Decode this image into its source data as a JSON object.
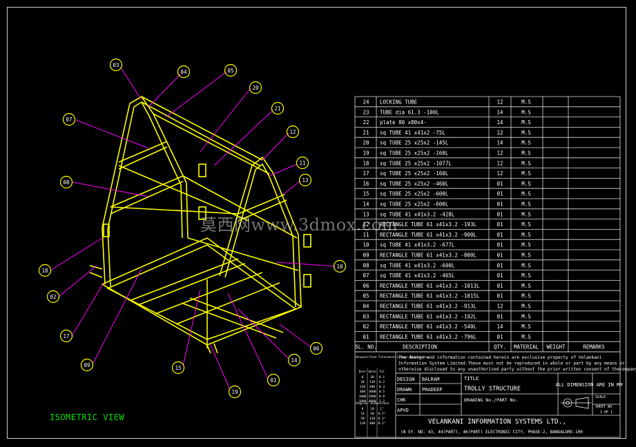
{
  "drawing": {
    "view_label": "ISOMETRIC VIEW",
    "watermark": "莫西网www.3dmox.com",
    "balloons": [
      "03",
      "04",
      "05",
      "20",
      "21",
      "12",
      "11",
      "13",
      "07",
      "08",
      "18",
      "10",
      "02",
      "17",
      "09",
      "15",
      "19",
      "01",
      "14",
      "06"
    ]
  },
  "bom": {
    "rows": [
      {
        "sl": "24",
        "desc": "LOCKING TUBE",
        "qty": "12",
        "mat": "M.S"
      },
      {
        "sl": "23",
        "desc": "TUBE dia 61.3 -100L",
        "qty": "14",
        "mat": "M.S"
      },
      {
        "sl": "22",
        "desc": "plate 80 x80x4-",
        "qty": "14",
        "mat": "M.S"
      },
      {
        "sl": "21",
        "desc": "sq TUBE 41 x41x2 -75L",
        "qty": "12",
        "mat": "M.S"
      },
      {
        "sl": "20",
        "desc": "sq TUBE 25 x25x2 -145L",
        "qty": "14",
        "mat": "M.S"
      },
      {
        "sl": "19",
        "desc": "sq TUBE 25 x25x2 -160L",
        "qty": "12",
        "mat": "M.S"
      },
      {
        "sl": "18",
        "desc": "sq TUBE 25 x25x2 -1077L",
        "qty": "12",
        "mat": "M.S"
      },
      {
        "sl": "17",
        "desc": "sq TUBE 25 x25x2 -160L",
        "qty": "12",
        "mat": "M.S"
      },
      {
        "sl": "16",
        "desc": "sq TUBE 25 x25x2 -460L",
        "qty": "01",
        "mat": "M.S"
      },
      {
        "sl": "15",
        "desc": "sq TUBE 25 x25x2 -600L",
        "qty": "01",
        "mat": "M.S"
      },
      {
        "sl": "14",
        "desc": "sq TUBE 25 x25x2 -600L",
        "qty": "01",
        "mat": "M.S"
      },
      {
        "sl": "13",
        "desc": "sq TUBE 41 x41x3.2 -428L",
        "qty": "01",
        "mat": "M.S"
      },
      {
        "sl": "12",
        "desc": "RECTANGLE TUBE 61 x41x3.2 -193L",
        "qty": "01",
        "mat": "M.S"
      },
      {
        "sl": "11",
        "desc": "RECTANGLE TUBE 61 x41x3.2 -900L",
        "qty": "01",
        "mat": "M.S"
      },
      {
        "sl": "10",
        "desc": "sq TUBE 41 x41x3.2 -677L",
        "qty": "01",
        "mat": "M.S"
      },
      {
        "sl": "09",
        "desc": "RECTANGLE TUBE 61 x41x3.2 -800L",
        "qty": "01",
        "mat": "M.S"
      },
      {
        "sl": "08",
        "desc": "sq TUBE 41 x41x3.2 -600L",
        "qty": "01",
        "mat": "M.S"
      },
      {
        "sl": "07",
        "desc": "sq TUBE 41 x41x3.2 -465L",
        "qty": "01",
        "mat": "M.S"
      },
      {
        "sl": "06",
        "desc": "RECTANGLE TUBE 61 x41x3.2 -1013L",
        "qty": "01",
        "mat": "M.S"
      },
      {
        "sl": "05",
        "desc": "RECTANGLE TUBE 61 x41x3.2 -1015L",
        "qty": "01",
        "mat": "M.S"
      },
      {
        "sl": "04",
        "desc": "RECTANGLE TUBE 61 x41x3.2 -913L",
        "qty": "12",
        "mat": "M.S"
      },
      {
        "sl": "03",
        "desc": "RECTANGLE TUBE 61 x41x3.2 -192L",
        "qty": "01",
        "mat": "M.S"
      },
      {
        "sl": "02",
        "desc": "RECTANGLE TUBE 61 x41x3.2 -540L",
        "qty": "14",
        "mat": "M.S"
      },
      {
        "sl": "01",
        "desc": "RECTANGLE TUBE 61 x41x3.2 -796L",
        "qty": "01",
        "mat": "M.S"
      }
    ],
    "headers": {
      "sl": "SL. NO.",
      "desc": "DESCRIPTION",
      "qty": "QTY.",
      "mat": "MATERIAL",
      "weight": "WEIGHT",
      "remarks": "REMARKS"
    }
  },
  "title_block": {
    "tolerance_note": "Unspecified Tolerance Linear Dimensions",
    "notice_lines": [
      "The design and information contained herein are exclusive property of Velankani",
      "Information System Limited.These must not be reproduced in whole or part by any means or",
      "otherwise disclosed to any unauthorized party without the prior written consent of thecompany."
    ],
    "roles": [
      {
        "role": "DESIGN",
        "name": "BALRAM"
      },
      {
        "role": "DRAWN",
        "name": "PRADEEP"
      },
      {
        "role": "CHK",
        "name": ""
      },
      {
        "role": "APVD",
        "name": ""
      }
    ],
    "title_label": "TITLE",
    "title": "TROLLY STRUCTURE",
    "drawing_no_label": "DRAWING No./PART No.",
    "dimension_note": "ALL DIMENSION ARE IN MM",
    "scale_label": "SCALE",
    "sheet_label": "SHEET NO",
    "sheet_value": "1 OF 1",
    "company": "VELANKANI INFORMATION SYSTEMS LTD.,",
    "address": "(N SY. NO. 43, 44(PART), 46(PART) ELECTRONIC CITY, PHASE-2, BANGALORE-100",
    "tol_headers": [
      "Over",
      "Upto",
      "Tol"
    ],
    "tol_rows": [
      [
        "0",
        "30",
        "0.1"
      ],
      [
        "30",
        "120",
        "0.2"
      ],
      [
        "120",
        "400",
        "0.3"
      ],
      [
        "400",
        "1000",
        "0.5"
      ],
      [
        "1000",
        "2000",
        "0.8"
      ],
      [
        "2000",
        "4000",
        "1.2"
      ]
    ],
    "angular_note": "Angular Dimensions",
    "angle_rows": [
      [
        "0",
        "10",
        "1°"
      ],
      [
        "10",
        "50",
        "0.5°"
      ],
      [
        "50",
        "120",
        "0.3°"
      ],
      [
        "120",
        "400",
        "0.1°"
      ]
    ]
  },
  "colors": {
    "frame": "#ffff00",
    "leader": "#ff00ff",
    "balloon": "#ffff00",
    "grid": "#e0e0e0",
    "label": "#00e000"
  }
}
